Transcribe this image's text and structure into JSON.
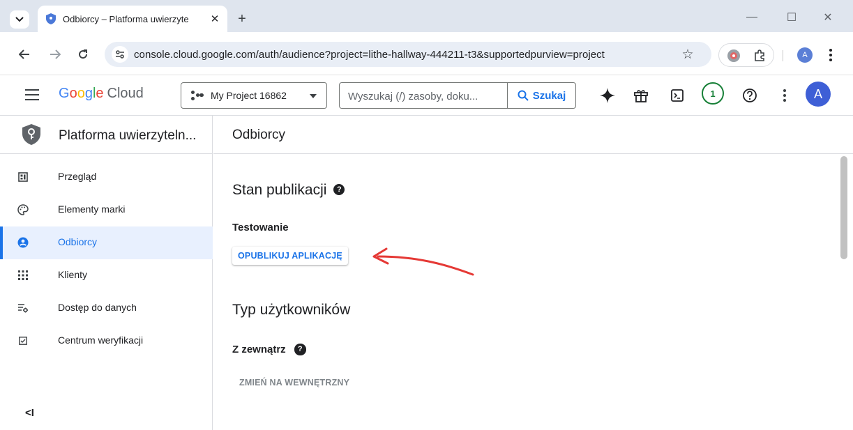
{
  "browser": {
    "tab": {
      "title": "Odbiorcy – Platforma uwierzyte",
      "favicon": "shield-icon"
    },
    "new_tab_label": "+",
    "window_controls": {
      "minimize": "—",
      "maximize": "☐",
      "close": "✕"
    },
    "url": "console.cloud.google.com/auth/audience?project=lithe-hallway-444211-t3&supportedpurview=project",
    "profile_initial": "A"
  },
  "header": {
    "logo": {
      "google": "Google",
      "cloud": "Cloud"
    },
    "project_name": "My Project 16862",
    "search": {
      "placeholder": "Wyszukaj (/) zasoby, doku...",
      "button_label": "Szukaj"
    },
    "notification_count": "1",
    "avatar_initial": "A"
  },
  "sidebar": {
    "title": "Platforma uwierzyteln...",
    "items": [
      {
        "label": "Przegląd",
        "icon": "dashboard-icon",
        "active": false
      },
      {
        "label": "Elementy marki",
        "icon": "palette-icon",
        "active": false
      },
      {
        "label": "Odbiorcy",
        "icon": "person-circle-icon",
        "active": true
      },
      {
        "label": "Klienty",
        "icon": "grid-icon",
        "active": false
      },
      {
        "label": "Dostęp do danych",
        "icon": "data-settings-icon",
        "active": false
      },
      {
        "label": "Centrum weryfikacji",
        "icon": "checkbox-icon",
        "active": false
      }
    ],
    "collapse_label": "<I"
  },
  "main": {
    "page_title": "Odbiorcy",
    "publishing": {
      "title": "Stan publikacji",
      "status": "Testowanie",
      "publish_button": "OPUBLIKUJ APLIKACJĘ"
    },
    "user_type": {
      "title": "Typ użytkowników",
      "value": "Z zewnątrz",
      "change_button": "ZMIEŃ NA WEWNĘTRZNY"
    }
  },
  "colors": {
    "accent": "#1a73e8",
    "active_bg": "#e8f0fe",
    "annotation": "#e53935",
    "notification": "#188038"
  }
}
